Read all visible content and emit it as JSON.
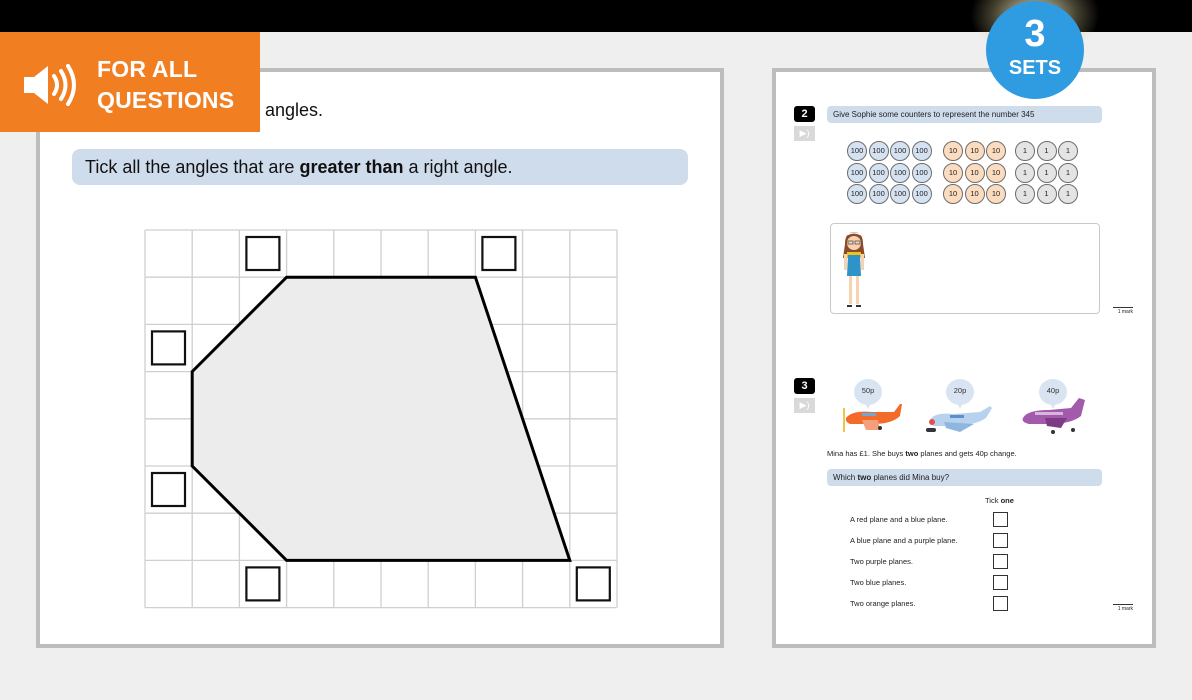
{
  "banner": {
    "icon": "speaker-icon",
    "line1": "FOR ALL",
    "line2": "QUESTIONS",
    "color": "#f27e22"
  },
  "sets_badge": {
    "number": "3",
    "label": "SETS",
    "color": "#2f9be0"
  },
  "left_page": {
    "prompt_tail": "angles.",
    "instruction_pre": "Tick all the angles that are ",
    "instruction_bold": "greater than",
    "instruction_post": " a right angle.",
    "grid": {
      "columns": 10,
      "rows": 8,
      "polygon_vertices_grid_units": [
        [
          3,
          1
        ],
        [
          7,
          1
        ],
        [
          9,
          7
        ],
        [
          3,
          7
        ],
        [
          1,
          5
        ],
        [
          1,
          3
        ]
      ],
      "tick_boxes": [
        {
          "angle": "top-left vertex",
          "checked": false
        },
        {
          "angle": "top-right vertex",
          "checked": false
        },
        {
          "angle": "upper-left vertex",
          "checked": false
        },
        {
          "angle": "lower-left vertex",
          "checked": false
        },
        {
          "angle": "bottom-left vertex",
          "checked": false
        },
        {
          "angle": "bottom-right vertex",
          "checked": false
        }
      ],
      "shape_fill": "#ececec"
    }
  },
  "right_page": {
    "q2": {
      "number": "2",
      "audio_icon": "speaker-icon",
      "prompt": "Give Sophie some counters to represent the number 345",
      "counters": {
        "hundreds": {
          "label": "100",
          "rows": 3,
          "per_row": 4
        },
        "tens": {
          "label": "10",
          "rows": 3,
          "per_row": 3
        },
        "ones": {
          "label": "1",
          "rows": 3,
          "per_row": 3
        }
      },
      "character": "Sophie",
      "mark": "1 mark"
    },
    "q3": {
      "number": "3",
      "audio_icon": "speaker-icon",
      "planes": [
        {
          "color": "orange",
          "price": "50p"
        },
        {
          "color": "blue",
          "price": "20p"
        },
        {
          "color": "purple",
          "price": "40p"
        }
      ],
      "statement_pre": "Mina has £1. She buys ",
      "statement_bold": "two",
      "statement_post": " planes and gets 40p change.",
      "question_pre": "Which ",
      "question_bold": "two",
      "question_post": " planes did Mina buy?",
      "tick_pre": "Tick ",
      "tick_bold": "one",
      "options": [
        {
          "label": "A red plane and a blue plane.",
          "checked": false
        },
        {
          "label": "A blue plane and a purple plane.",
          "checked": false
        },
        {
          "label": "Two purple planes.",
          "checked": false
        },
        {
          "label": "Two blue planes.",
          "checked": false
        },
        {
          "label": "Two orange planes.",
          "checked": false
        }
      ],
      "mark": "1 mark"
    }
  }
}
